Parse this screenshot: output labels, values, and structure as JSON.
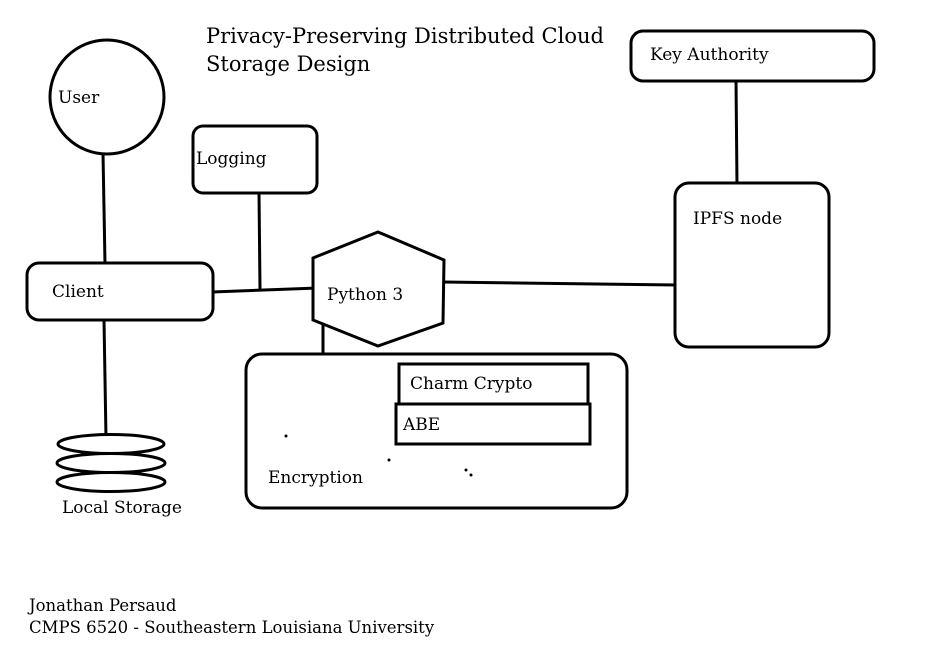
{
  "title": {
    "line1": "Privacy-Preserving Distributed Cloud",
    "line2": "Storage Design"
  },
  "nodes": {
    "user": "User",
    "logging": "Logging",
    "client": "Client",
    "python": "Python 3",
    "key_authority": "Key Authority",
    "ipfs_node": "IPFS node",
    "charm_crypto": "Charm Crypto",
    "abe": "ABE",
    "encryption": "Encryption",
    "local_storage": "Local Storage"
  },
  "footer": {
    "author": "Jonathan Persaud",
    "course": "CMPS 6520 - Southeastern Louisiana University"
  }
}
